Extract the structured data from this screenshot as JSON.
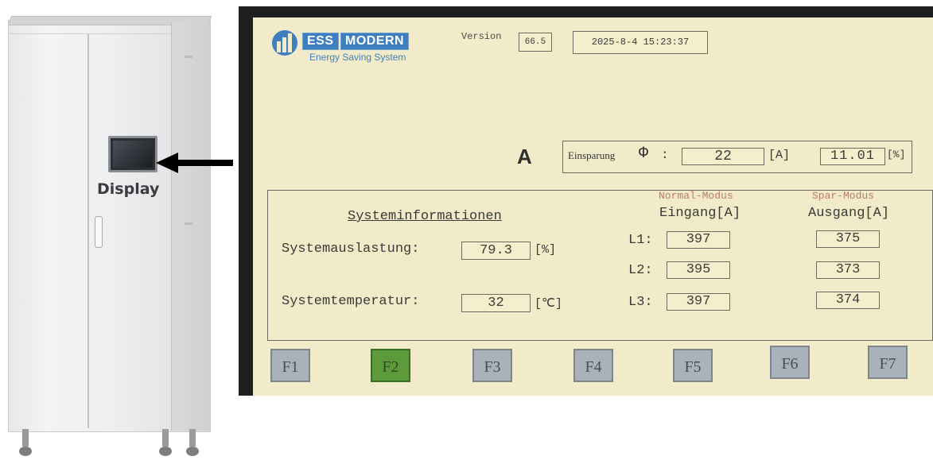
{
  "cabinet": {
    "display_label": "Display"
  },
  "hmi": {
    "logo": {
      "brand_left": "ESS",
      "brand_right": "MODERN",
      "subtitle": "Energy Saving System"
    },
    "version": {
      "label": "Version",
      "value": "66.5"
    },
    "datetime": "2025-8-4 15:23:37",
    "mode_letter": "A",
    "savings": {
      "label": "Einsparung",
      "symbol": "Φ",
      "colon": ":",
      "current_value": "22",
      "current_unit": "[A]",
      "percent_value": "11.01",
      "percent_unit": "[%]"
    },
    "system_info": {
      "title": "Systeminformationen",
      "utilization_label": "Systemauslastung:",
      "utilization_value": "79.3",
      "utilization_unit": "[%]",
      "temperature_label": "Systemtemperatur:",
      "temperature_value": "32",
      "temperature_unit": "[℃]"
    },
    "phases": {
      "normal_mode_label": "Normal-Modus",
      "save_mode_label": "Spar-Modus",
      "input_header": "Eingang[A]",
      "output_header": "Ausgang[A]",
      "rows": [
        {
          "label": "L1:",
          "input": "397",
          "output": "375"
        },
        {
          "label": "L2:",
          "input": "395",
          "output": "373"
        },
        {
          "label": "L3:",
          "input": "397",
          "output": "374"
        }
      ]
    },
    "function_keys": [
      "F1",
      "F2",
      "F3",
      "F4",
      "F5",
      "F6",
      "F7"
    ],
    "active_key": "F2",
    "colors": {
      "screen_bg": "#f1ebc9",
      "active_key": "#5d9a3c",
      "key": "#a8b2b8",
      "brand": "#3f7fbf",
      "mode_header": "#b77d70"
    }
  }
}
